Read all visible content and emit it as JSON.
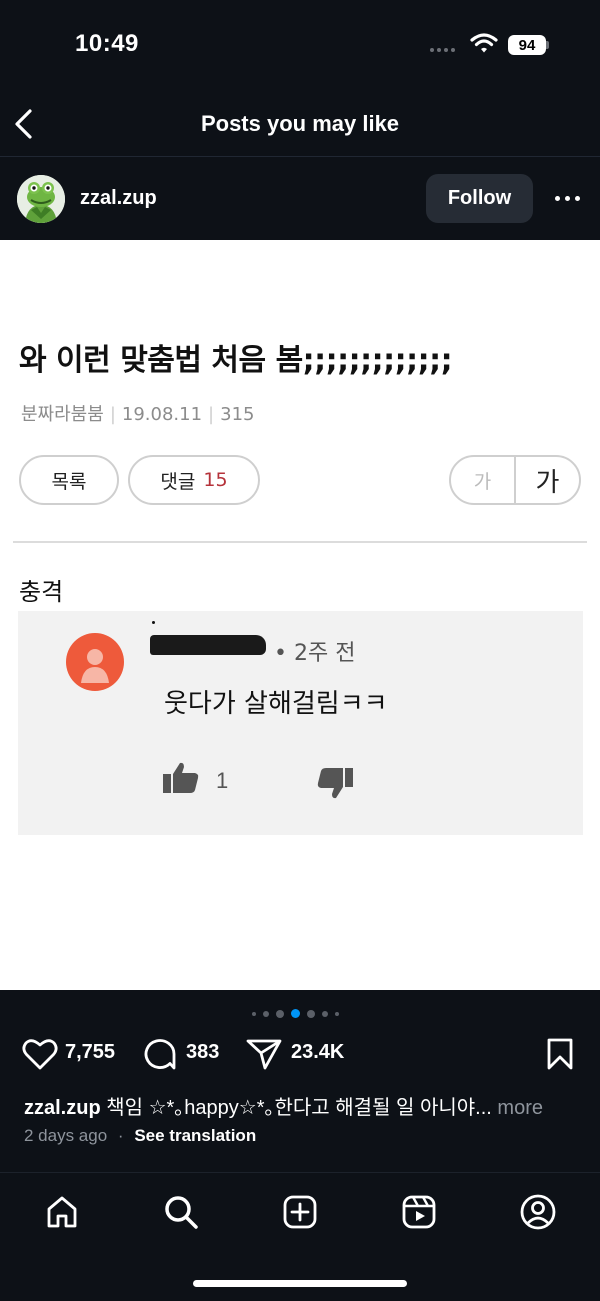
{
  "status_bar": {
    "time": "10:49",
    "battery": "94"
  },
  "nav": {
    "title": "Posts you may like"
  },
  "post": {
    "username": "zzal.zup",
    "follow_label": "Follow",
    "image": {
      "title": "와 이런 맞춤법 처음 봄;;;;;;;;;;;;;",
      "author": "분짜라붐붐",
      "date": "19.08.11",
      "views": "315",
      "list_button": "목록",
      "comments_label": "댓글",
      "comments_count": "15",
      "font_small": "가",
      "font_big": "가",
      "section_label": "충격",
      "comment": {
        "time": "• 2주 전",
        "text": "웃다가 살해걸림ㅋㅋ",
        "likes": "1"
      }
    },
    "carousel": {
      "total": 7,
      "active": 3
    },
    "likes": "7,755",
    "comments": "383",
    "shares": "23.4K",
    "caption_user": "zzal.zup",
    "caption_text": "책임 ☆*｡happy☆*｡한다고 해결될 일 아니야...",
    "caption_more": "more",
    "posted_ago": "2 days ago",
    "see_translation": "See translation"
  },
  "icons": [
    "back-icon",
    "wifi-icon",
    "more-icon",
    "heart-icon",
    "comment-icon",
    "share-icon",
    "bookmark-icon",
    "home-icon",
    "search-icon",
    "create-icon",
    "reels-icon",
    "profile-icon"
  ],
  "colors": {
    "background": "#0d1117",
    "accent": "#0095f6",
    "comment_count": "#b5323a"
  }
}
